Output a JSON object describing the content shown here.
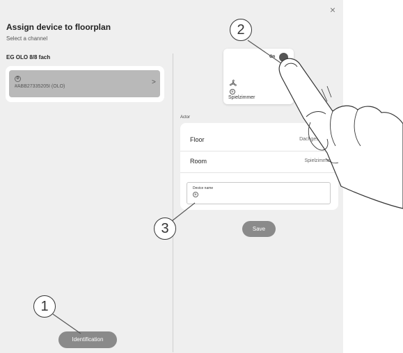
{
  "dialog": {
    "close_glyph": "×",
    "title": "Assign device to floorplan",
    "subtitle": "Select a channel"
  },
  "left": {
    "device_name": "EG OLO 8/8 fach",
    "channel": {
      "icon_letter": "D",
      "serial": "#ABB27335205I (OLO)",
      "chevron": ">"
    },
    "identification_button": "Identification"
  },
  "tile": {
    "state_label": "On",
    "icon": "fan-icon",
    "badge_letter": "D",
    "room": "Spielzimmer"
  },
  "actor": {
    "section_label": "Actor",
    "floor_label": "Floor",
    "floor_value": "Dachgeschoss",
    "room_label": "Room",
    "room_value": "Spielzimmer",
    "device_name_label": "Device name",
    "device_name_badge": "D",
    "save_button": "Save"
  },
  "callouts": [
    "1",
    "2",
    "3"
  ]
}
